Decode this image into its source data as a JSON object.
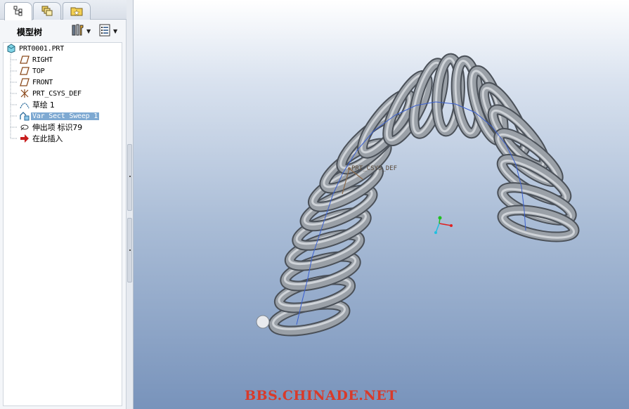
{
  "tabs": [
    {
      "icon": "model-tree-icon",
      "active": true
    },
    {
      "icon": "layers-icon",
      "active": false
    },
    {
      "icon": "favorites-folder-icon",
      "active": false
    }
  ],
  "tree_header": {
    "title": "模型树",
    "settings_icon": "tools-icon",
    "show_icon": "show-list-icon"
  },
  "tree": {
    "root": "PRT0001.PRT",
    "items": [
      {
        "label": "RIGHT",
        "icon": "datum-plane-icon"
      },
      {
        "label": "TOP",
        "icon": "datum-plane-icon"
      },
      {
        "label": "FRONT",
        "icon": "datum-plane-icon"
      },
      {
        "label": "PRT_CSYS_DEF",
        "icon": "coordinate-system-icon"
      },
      {
        "label": "草绘 1",
        "icon": "sketch-icon"
      },
      {
        "label": "Var Sect Sweep 1",
        "icon": "var-sect-sweep-icon",
        "selected": true
      },
      {
        "label": "伸出项 标识79",
        "icon": "protrusion-icon"
      },
      {
        "label": "在此插入",
        "icon": "insert-here-arrow-icon"
      }
    ]
  },
  "viewport": {
    "csys_label": "PRT_CSYS_DEF",
    "watermark": "BBS.CHINADE.NET"
  },
  "colors": {
    "spring_dark": "#4a5058",
    "spring_mid": "#8e949b",
    "spring_light": "#c4c8cd",
    "selection_bg": "#7ea9d2",
    "watermark": "#d93a2a",
    "datum_plane": "#8b4a1c",
    "insert_arrow": "#c81e1e",
    "axis_x": "#e02020",
    "axis_y": "#20c020",
    "axis_z": "#20c0e0"
  }
}
